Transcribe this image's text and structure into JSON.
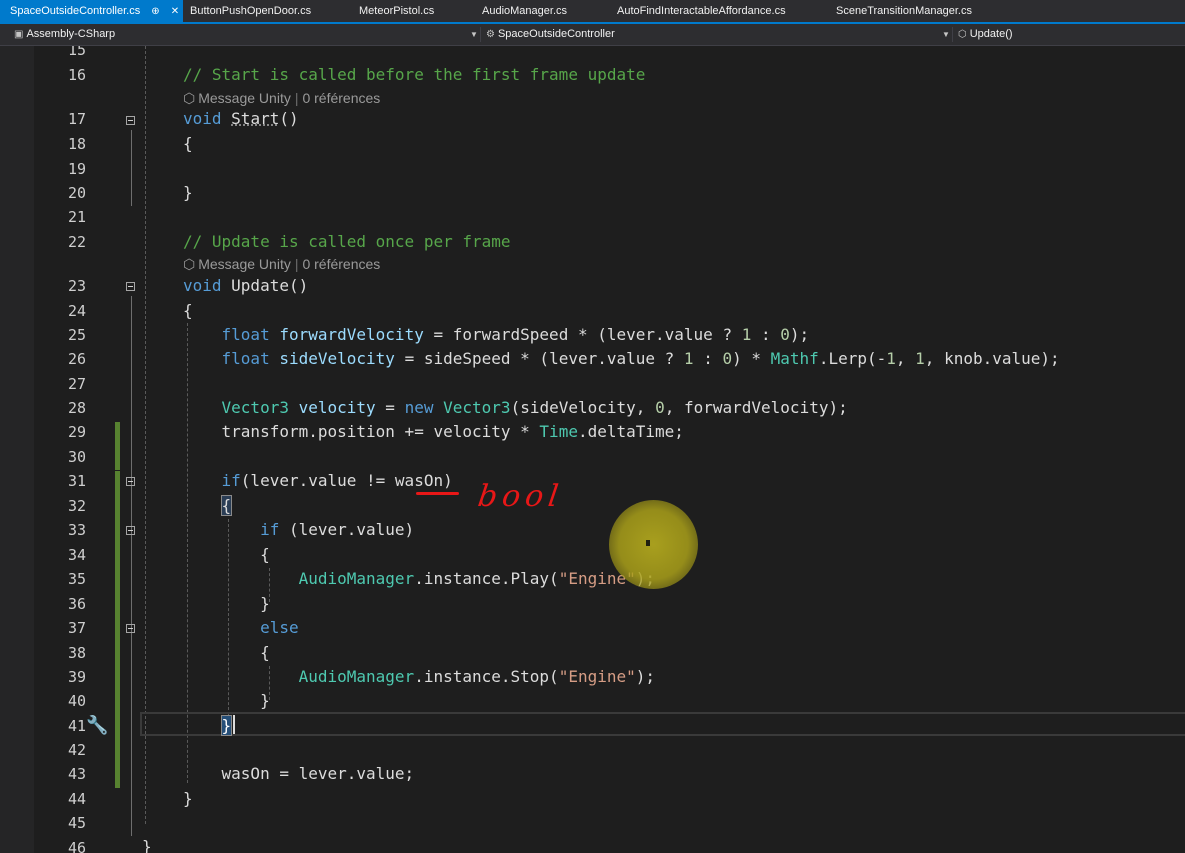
{
  "tabs": [
    {
      "label": "SpaceOutsideController.cs",
      "active": true,
      "pin": "⊕",
      "close": "✕"
    },
    {
      "label": "ButtonPushOpenDoor.cs"
    },
    {
      "label": "MeteorPistol.cs"
    },
    {
      "label": "AudioManager.cs"
    },
    {
      "label": "AutoFindInteractableAffordance.cs"
    },
    {
      "label": "SceneTransitionManager.cs"
    }
  ],
  "navbar": {
    "project": "Assembly-CSharp",
    "type": "SpaceOutsideController",
    "member": "Update()"
  },
  "codelens": {
    "kind": "Message Unity",
    "refs": "0 références"
  },
  "annotation": {
    "handwritten": "bool"
  },
  "lines": [
    {
      "n": "15",
      "segs": []
    },
    {
      "n": "16",
      "segs": [
        [
          "cm",
          "// Start is called before the first frame update"
        ]
      ]
    },
    {
      "n": "17",
      "segs": [
        [
          "kw",
          "void"
        ],
        [
          "",
          " "
        ],
        [
          "un",
          "Start"
        ],
        [
          "",
          "()"
        ]
      ]
    },
    {
      "n": "18",
      "segs": [
        [
          "",
          "{"
        ]
      ]
    },
    {
      "n": "19",
      "segs": []
    },
    {
      "n": "20",
      "segs": [
        [
          "",
          "}"
        ]
      ]
    },
    {
      "n": "21",
      "segs": []
    },
    {
      "n": "22",
      "segs": [
        [
          "cm",
          "// Update is called once per frame"
        ]
      ]
    },
    {
      "n": "23",
      "segs": [
        [
          "kw",
          "void"
        ],
        [
          "",
          " Update()"
        ]
      ]
    },
    {
      "n": "24",
      "segs": [
        [
          "",
          "{"
        ]
      ]
    },
    {
      "n": "25",
      "segs": [
        [
          "",
          "    "
        ],
        [
          "kw",
          "float"
        ],
        [
          "vr",
          " forwardVelocity"
        ],
        [
          "",
          " = forwardSpeed * (lever.value ? "
        ],
        [
          "nm",
          "1"
        ],
        [
          "",
          " : "
        ],
        [
          "nm",
          "0"
        ],
        [
          "",
          ");"
        ]
      ]
    },
    {
      "n": "26",
      "segs": [
        [
          "",
          "    "
        ],
        [
          "kw",
          "float"
        ],
        [
          "vr",
          " sideVelocity"
        ],
        [
          "",
          " = sideSpeed * (lever.value ? "
        ],
        [
          "nm",
          "1"
        ],
        [
          "",
          " : "
        ],
        [
          "nm",
          "0"
        ],
        [
          "",
          ") * "
        ],
        [
          "ty",
          "Mathf"
        ],
        [
          "",
          ".Lerp(-"
        ],
        [
          "nm",
          "1"
        ],
        [
          "",
          ", "
        ],
        [
          "nm",
          "1"
        ],
        [
          "",
          ", knob.value);"
        ]
      ]
    },
    {
      "n": "27",
      "segs": []
    },
    {
      "n": "28",
      "segs": [
        [
          "",
          "    "
        ],
        [
          "ty",
          "Vector3"
        ],
        [
          "vr",
          " velocity"
        ],
        [
          "",
          " = "
        ],
        [
          "kw",
          "new"
        ],
        [
          "",
          " "
        ],
        [
          "ty",
          "Vector3"
        ],
        [
          "",
          "(sideVelocity, "
        ],
        [
          "nm",
          "0"
        ],
        [
          "",
          ", forwardVelocity);"
        ]
      ]
    },
    {
      "n": "29",
      "segs": [
        [
          "",
          "    transform.position += velocity * "
        ],
        [
          "ty",
          "Time"
        ],
        [
          "",
          ".deltaTime;"
        ]
      ]
    },
    {
      "n": "30",
      "segs": []
    },
    {
      "n": "31",
      "segs": [
        [
          "",
          "    "
        ],
        [
          "kw",
          "if"
        ],
        [
          "",
          "(lever.value != wasOn)"
        ]
      ]
    },
    {
      "n": "32",
      "segs": [
        [
          "",
          "    "
        ],
        [
          "hl",
          "{"
        ]
      ]
    },
    {
      "n": "33",
      "segs": [
        [
          "",
          "        "
        ],
        [
          "kw",
          "if"
        ],
        [
          "",
          " (lever.value)"
        ]
      ]
    },
    {
      "n": "34",
      "segs": [
        [
          "",
          "        {"
        ]
      ]
    },
    {
      "n": "35",
      "segs": [
        [
          "",
          "            "
        ],
        [
          "ty",
          "AudioManager"
        ],
        [
          "",
          ".instance.Play("
        ],
        [
          "st",
          "\"Engine\""
        ],
        [
          "",
          ");"
        ]
      ]
    },
    {
      "n": "36",
      "segs": [
        [
          "",
          "        }"
        ]
      ]
    },
    {
      "n": "37",
      "segs": [
        [
          "",
          "        "
        ],
        [
          "kw",
          "else"
        ]
      ]
    },
    {
      "n": "38",
      "segs": [
        [
          "",
          "        {"
        ]
      ]
    },
    {
      "n": "39",
      "segs": [
        [
          "",
          "            "
        ],
        [
          "ty",
          "AudioManager"
        ],
        [
          "",
          ".instance.Stop("
        ],
        [
          "st",
          "\"Engine\""
        ],
        [
          "",
          ");"
        ]
      ]
    },
    {
      "n": "40",
      "segs": [
        [
          "",
          "        }"
        ]
      ]
    },
    {
      "n": "41",
      "segs": [
        [
          "",
          "    "
        ],
        [
          "hlb",
          "}"
        ]
      ]
    },
    {
      "n": "42",
      "segs": []
    },
    {
      "n": "43",
      "segs": [
        [
          "",
          "    wasOn = lever.value;"
        ]
      ]
    },
    {
      "n": "44",
      "segs": [
        [
          "",
          "}"
        ]
      ]
    },
    {
      "n": "45",
      "segs": []
    },
    {
      "n": "46",
      "segs": []
    }
  ],
  "line45_brace": "}"
}
